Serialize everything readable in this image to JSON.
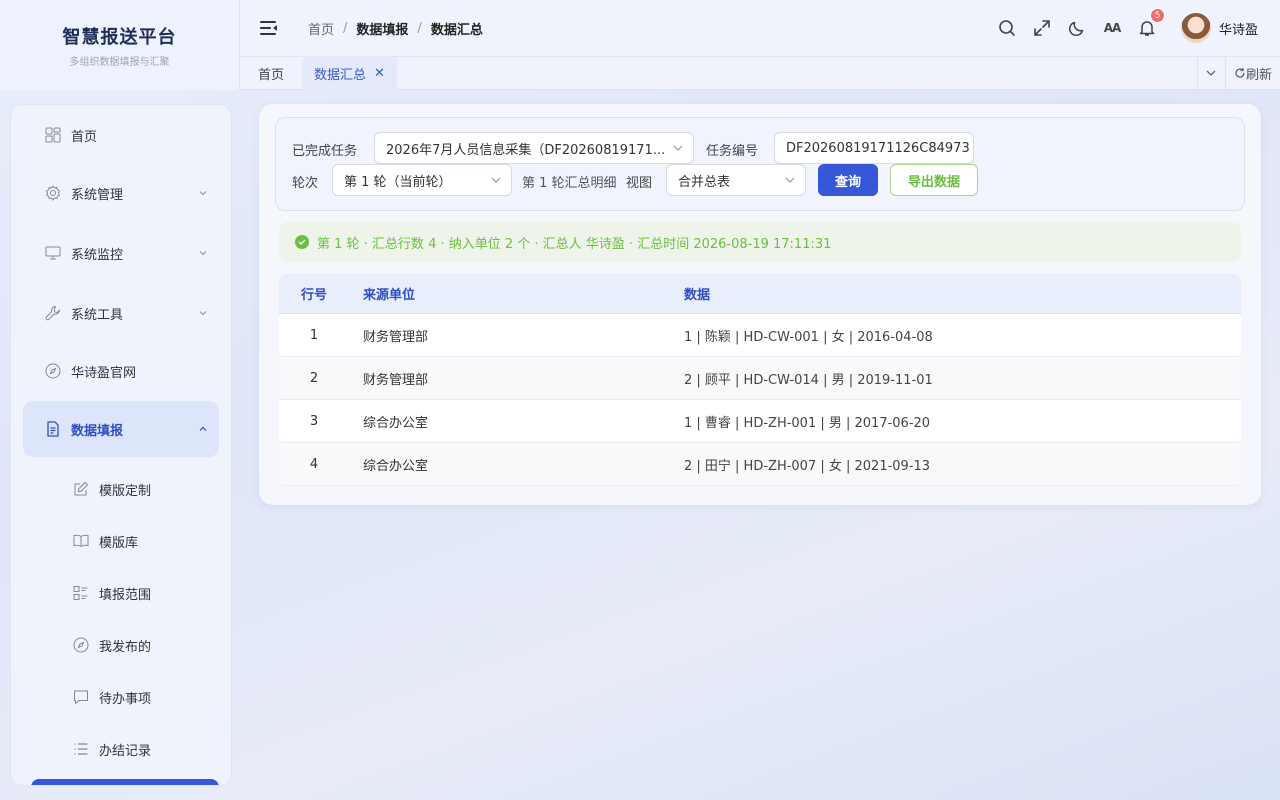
{
  "brand": {
    "title": "智慧报送平台",
    "subtitle": "多组织数据填报与汇聚"
  },
  "header": {
    "breadcrumb": [
      "首页",
      "数据填报",
      "数据汇总"
    ],
    "notification_count": "5",
    "font_toggle": "AA",
    "username": "华诗盈"
  },
  "tabs": [
    {
      "label": "首页"
    },
    {
      "label": "数据汇总",
      "close": "✕"
    }
  ],
  "tab_tools": {
    "refresh": "刷新"
  },
  "sidebar": {
    "items": [
      {
        "label": "首页",
        "icon": "dashboard-icon"
      },
      {
        "label": "系统管理",
        "icon": "gear-icon"
      },
      {
        "label": "系统监控",
        "icon": "monitor-icon"
      },
      {
        "label": "系统工具",
        "icon": "wrench-icon"
      },
      {
        "label": "华诗盈官网",
        "icon": "compass-icon"
      },
      {
        "label": "数据填报",
        "icon": "document-icon"
      }
    ],
    "subitems": [
      {
        "label": "模版定制",
        "icon": "edit-icon"
      },
      {
        "label": "模版库",
        "icon": "book-icon"
      },
      {
        "label": "填报范围",
        "icon": "list-icon"
      },
      {
        "label": "我发布的",
        "icon": "compass-icon"
      },
      {
        "label": "待办事项",
        "icon": "chat-icon"
      },
      {
        "label": "办结记录",
        "icon": "list-icon"
      }
    ]
  },
  "filters": {
    "task_label": "已完成任务",
    "task_value": "2026年7月人员信息采集（DF20260819171...",
    "task_no_label": "任务编号",
    "task_no_value": "DF20260819171126C84973",
    "round_label": "轮次",
    "round_value": "第 1 轮（当前轮）",
    "round_detail": "第 1 轮汇总明细",
    "view_label": "视图",
    "view_value": "合并总表",
    "query_button": "查询",
    "export_button": "导出数据"
  },
  "summary": {
    "text": "第 1 轮 · 汇总行数 4 · 纳入单位 2 个 · 汇总人 华诗盈 · 汇总时间 2026-08-19 17:11:31"
  },
  "table": {
    "headers": [
      "行号",
      "来源单位",
      "数据"
    ],
    "rows": [
      [
        "1",
        "财务管理部",
        "1 | 陈颖 | HD-CW-001 | 女 | 2016-04-08"
      ],
      [
        "2",
        "财务管理部",
        "2 | 顾平 | HD-CW-014 | 男 | 2019-11-01"
      ],
      [
        "3",
        "综合办公室",
        "1 | 曹睿 | HD-ZH-001 | 男 | 2017-06-20"
      ],
      [
        "4",
        "综合办公室",
        "2 | 田宁 | HD-ZH-007 | 女 | 2021-09-13"
      ]
    ]
  },
  "colors": {
    "primary": "#3658d8",
    "success": "#6cbf3e",
    "badge": "#f06c6c"
  }
}
